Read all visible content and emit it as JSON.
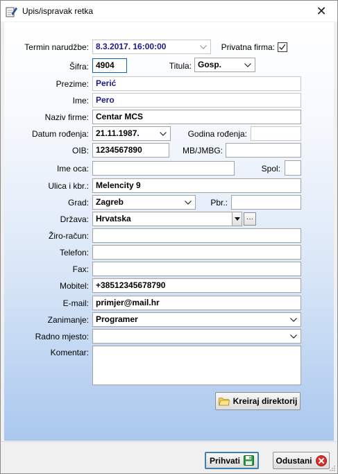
{
  "window": {
    "title": "Upis/ispravak retka",
    "close_icon": "close-icon",
    "app_icon": "edit-pencil-icon"
  },
  "form": {
    "termin_label": "Termin narudžbe:",
    "termin_value": "8.3.2017. 16:00:00",
    "privatna_label": "Privatna firma:",
    "privatna_checked": true,
    "sifra_label": "Šifra:",
    "sifra_value": "4904",
    "titula_label": "Titula:",
    "titula_value": "Gosp.",
    "prezime_label": "Prezime:",
    "prezime_value": "Perić",
    "ime_label": "Ime:",
    "ime_value": "Pero",
    "naziv_label": "Naziv firme:",
    "naziv_value": "Centar MCS",
    "datum_label": "Datum rođenja:",
    "datum_value": "21.11.1987.",
    "godina_label": "Godina rođenja:",
    "godina_value": "",
    "oib_label": "OIB:",
    "oib_value": "1234567890",
    "mb_label": "MB/JMBG:",
    "mb_value": "",
    "imeoca_label": "Ime oca:",
    "imeoca_value": "",
    "spol_label": "Spol:",
    "spol_value": "",
    "ulica_label": "Ulica i kbr.:",
    "ulica_value": "Melencity 9",
    "grad_label": "Grad:",
    "grad_value": "Zagreb",
    "pbr_label": "Pbr.:",
    "pbr_value": "",
    "drzava_label": "Država:",
    "drzava_value": "Hrvatska",
    "ziro_label": "Žiro-račun:",
    "ziro_value": "",
    "telefon_label": "Telefon:",
    "telefon_value": "",
    "fax_label": "Fax:",
    "fax_value": "",
    "mobitel_label": "Mobitel:",
    "mobitel_value": "+38512345678790",
    "email_label": "E-mail:",
    "email_value": "primjer@mail.hr",
    "zanimanje_label": "Zanimanje:",
    "zanimanje_value": "Programer",
    "radno_label": "Radno mjesto:",
    "radno_value": "",
    "komentar_label": "Komentar:",
    "komentar_value": "",
    "kreiraj_label": "Kreiraj direktorij"
  },
  "footer": {
    "prihvati_label": "Prihvati",
    "odustani_label": "Odustani"
  },
  "colors": {
    "accent_blue_text": "#1a1a8c",
    "default_button_border": "#3c7fb1",
    "cancel_icon": "#d9322b",
    "save_icon": "#1f8f3a"
  }
}
